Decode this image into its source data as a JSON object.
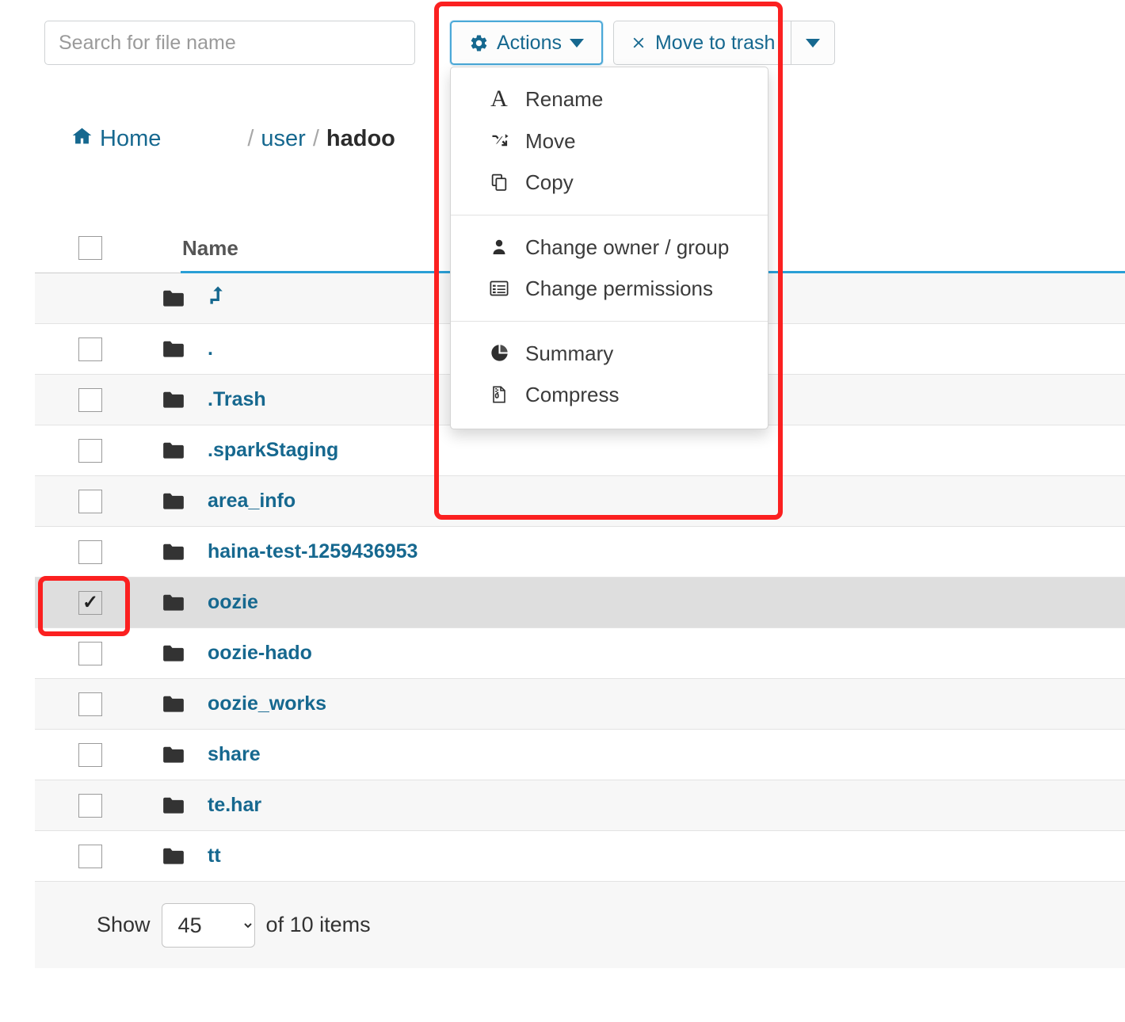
{
  "toolbar": {
    "search_placeholder": "Search for file name",
    "search_value": "",
    "actions_label": "Actions",
    "actions_icon": "gear-icon",
    "trash_label": "Move to trash",
    "trash_icon": "x-icon",
    "split_caret_icon": "caret-down-icon"
  },
  "actions_menu": {
    "groups": [
      {
        "items": [
          {
            "label": "Rename",
            "icon": "letter-a-icon"
          },
          {
            "label": "Move",
            "icon": "shuffle-icon"
          },
          {
            "label": "Copy",
            "icon": "copy-icon"
          }
        ]
      },
      {
        "items": [
          {
            "label": "Change owner / group",
            "icon": "user-icon"
          },
          {
            "label": "Change permissions",
            "icon": "list-alt-icon"
          }
        ]
      },
      {
        "items": [
          {
            "label": "Summary",
            "icon": "pie-chart-icon"
          },
          {
            "label": "Compress",
            "icon": "file-archive-icon"
          }
        ]
      }
    ]
  },
  "breadcrumb": {
    "home_label": "Home",
    "home_icon": "home-icon",
    "separator": "/",
    "items": [
      {
        "label": "user",
        "current": false
      },
      {
        "label": "hadoo",
        "current": true
      }
    ]
  },
  "table": {
    "columns": [
      "Name"
    ],
    "header_checkbox_checked": false,
    "rows": [
      {
        "name": "",
        "icon": "folder-icon",
        "name_icon": "level-up-icon",
        "checkbox": false,
        "show_checkbox": false,
        "selected": false,
        "striped": true
      },
      {
        "name": ".",
        "icon": "folder-icon",
        "checkbox": false,
        "show_checkbox": true,
        "selected": false,
        "striped": false
      },
      {
        "name": ".Trash",
        "icon": "folder-icon",
        "checkbox": false,
        "show_checkbox": true,
        "selected": false,
        "striped": true
      },
      {
        "name": ".sparkStaging",
        "icon": "folder-icon",
        "checkbox": false,
        "show_checkbox": true,
        "selected": false,
        "striped": false
      },
      {
        "name": "area_info",
        "icon": "folder-icon",
        "checkbox": false,
        "show_checkbox": true,
        "selected": false,
        "striped": true
      },
      {
        "name": "haina-test-1259436953",
        "icon": "folder-icon",
        "checkbox": false,
        "show_checkbox": true,
        "selected": false,
        "striped": false
      },
      {
        "name": "oozie",
        "icon": "folder-icon",
        "checkbox": true,
        "show_checkbox": true,
        "selected": true,
        "striped": false
      },
      {
        "name": "oozie-hado",
        "icon": "folder-icon",
        "checkbox": false,
        "show_checkbox": true,
        "selected": false,
        "striped": false
      },
      {
        "name": "oozie_works",
        "icon": "folder-icon",
        "checkbox": false,
        "show_checkbox": true,
        "selected": false,
        "striped": true
      },
      {
        "name": "share",
        "icon": "folder-icon",
        "checkbox": false,
        "show_checkbox": true,
        "selected": false,
        "striped": false
      },
      {
        "name": "te.har",
        "icon": "folder-icon",
        "checkbox": false,
        "show_checkbox": true,
        "selected": false,
        "striped": true
      },
      {
        "name": "tt",
        "icon": "folder-icon",
        "checkbox": false,
        "show_checkbox": true,
        "selected": false,
        "striped": false
      }
    ]
  },
  "footer": {
    "show_label": "Show",
    "page_size": "45",
    "page_size_options": [
      "45"
    ],
    "items_label": "of 10 items"
  },
  "colors": {
    "link": "#16688f",
    "accent": "#2a9fd6",
    "focus_border": "#4aa8d8",
    "highlight": "#fb2020",
    "selected_row": "#dedede",
    "stripe": "#f7f7f7"
  }
}
